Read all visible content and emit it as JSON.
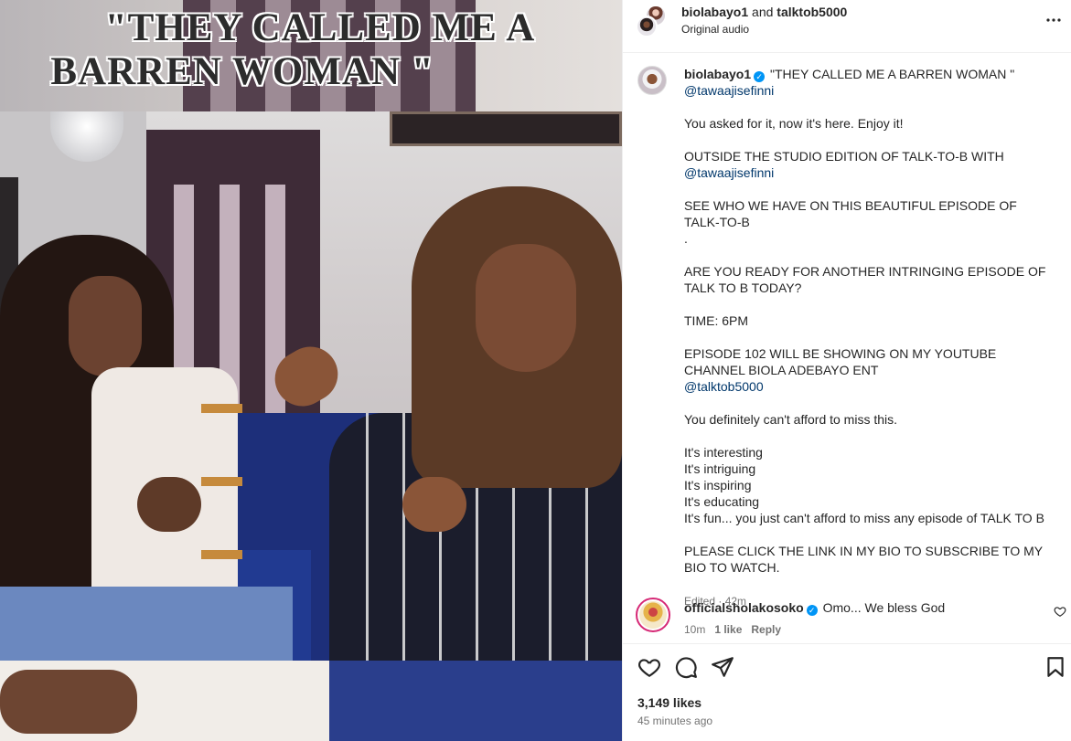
{
  "media": {
    "caption_line1": "\"THEY CALLED ME A",
    "caption_line2": "BARREN WOMAN \""
  },
  "header": {
    "user1": "biolabayo1",
    "and_text": " and ",
    "user2": "talktob5000",
    "audio": "Original audio",
    "more_icon": "more-options-icon"
  },
  "post": {
    "username": "biolabayo1",
    "verified_icon": "verified-badge-icon",
    "title": "\"THEY CALLED ME A BARREN WOMAN \"",
    "mention1": "@tawaajisefinni",
    "p1": "You asked for it, now it's here. Enjoy it!",
    "p2": "OUTSIDE THE STUDIO EDITION OF TALK-TO-B WITH",
    "mention2": "@tawaajisefinni",
    "p3": "SEE WHO WE HAVE ON THIS BEAUTIFUL EPISODE OF TALK-TO-B\n.",
    "p4": "ARE YOU READY FOR ANOTHER INTRINGING EPISODE OF TALK TO B TODAY?",
    "p5": "TIME: 6PM",
    "p6": "EPISODE 102 WILL BE SHOWING ON MY YOUTUBE CHANNEL BIOLA ADEBAYO ENT",
    "mention3": "@talktob5000",
    "p7": "You definitely can't afford to miss this.",
    "p8": "It's interesting\nIt's intriguing\nIt's inspiring\nIt's educating\nIt's fun... you just can't afford to miss any episode of TALK TO B",
    "p9": "PLEASE CLICK THE LINK IN MY BIO TO SUBSCRIBE TO MY BIO TO WATCH.",
    "edited": "Edited · 42m"
  },
  "comment": {
    "username": "officialsholakosoko",
    "text": "Omo... We bless God",
    "time": "10m",
    "likes": "1 like",
    "reply": "Reply"
  },
  "actions": {
    "like_icon": "heart-icon",
    "comment_icon": "comment-icon",
    "share_icon": "share-icon",
    "save_icon": "bookmark-icon",
    "likes": "3,149 likes",
    "time_ago": "45 minutes ago"
  }
}
